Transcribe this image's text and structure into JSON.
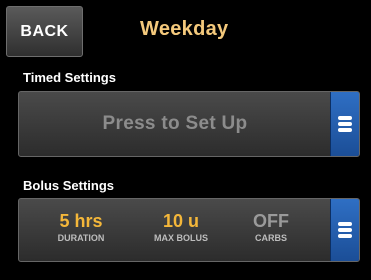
{
  "header": {
    "back_label": "BACK",
    "title": "Weekday"
  },
  "timed_settings": {
    "label": "Timed Settings",
    "button_label": "Press to Set Up"
  },
  "bolus_settings": {
    "label": "Bolus Settings",
    "stats": [
      {
        "value": "5 hrs",
        "caption": "DURATION"
      },
      {
        "value": "10 u",
        "caption": "MAX BOLUS"
      },
      {
        "value": "OFF",
        "caption": "CARBS"
      }
    ]
  },
  "colors": {
    "title": "#f4c97c",
    "value_active": "#f4b73a",
    "value_off": "#9a9a9a",
    "menu_tab": "#2f6fc4"
  },
  "icons": {
    "menu": "menu-icon"
  }
}
